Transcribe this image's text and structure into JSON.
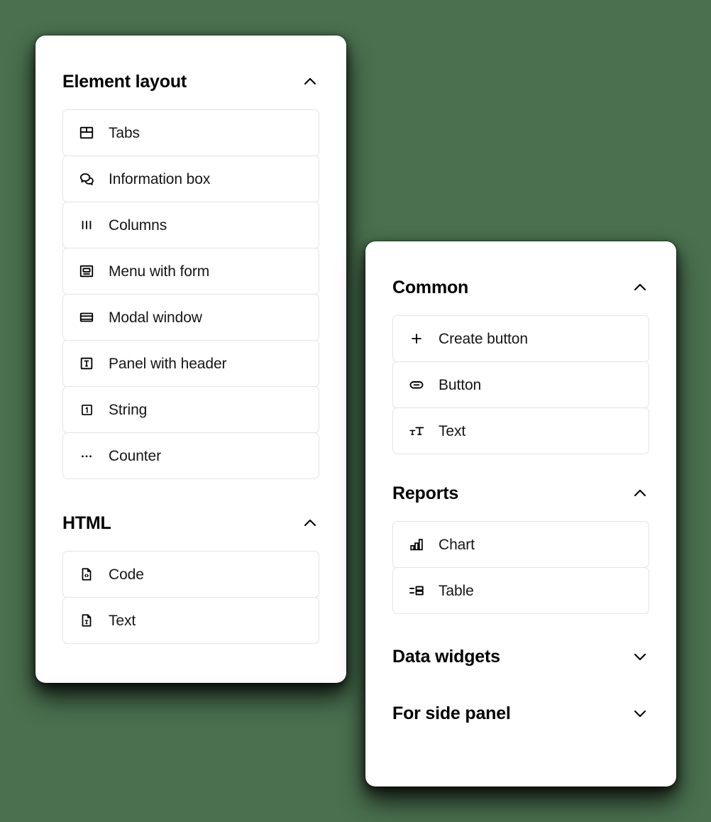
{
  "background_color": "#4a704f",
  "panels": [
    {
      "name": "element-layout-panel",
      "sections": [
        {
          "title": "Element layout",
          "expanded": true,
          "chevron": "chevron-up-icon",
          "items": [
            {
              "label": "Tabs",
              "icon": "tabs-icon"
            },
            {
              "label": "Information box",
              "icon": "information-box-icon"
            },
            {
              "label": "Columns",
              "icon": "columns-icon"
            },
            {
              "label": "Menu with form",
              "icon": "menu-with-form-icon"
            },
            {
              "label": "Modal window",
              "icon": "modal-window-icon"
            },
            {
              "label": "Panel with header",
              "icon": "panel-with-header-icon"
            },
            {
              "label": "String",
              "icon": "string-icon"
            },
            {
              "label": "Counter",
              "icon": "counter-icon"
            }
          ]
        },
        {
          "title": "HTML",
          "expanded": true,
          "chevron": "chevron-up-icon",
          "items": [
            {
              "label": "Code",
              "icon": "code-file-icon"
            },
            {
              "label": "Text",
              "icon": "text-file-icon"
            }
          ]
        }
      ]
    },
    {
      "name": "widgets-panel",
      "sections": [
        {
          "title": "Common",
          "expanded": true,
          "chevron": "chevron-up-icon",
          "items": [
            {
              "label": "Create button",
              "icon": "plus-icon"
            },
            {
              "label": "Button",
              "icon": "button-pill-icon"
            },
            {
              "label": "Text",
              "icon": "text-size-icon"
            }
          ]
        },
        {
          "title": "Reports",
          "expanded": true,
          "chevron": "chevron-up-icon",
          "items": [
            {
              "label": "Chart",
              "icon": "chart-bars-icon"
            },
            {
              "label": "Table",
              "icon": "table-icon"
            }
          ]
        },
        {
          "title": "Data widgets",
          "expanded": false,
          "chevron": "chevron-down-icon",
          "items": []
        },
        {
          "title": "For side panel",
          "expanded": false,
          "chevron": "chevron-down-icon",
          "items": []
        }
      ]
    }
  ]
}
